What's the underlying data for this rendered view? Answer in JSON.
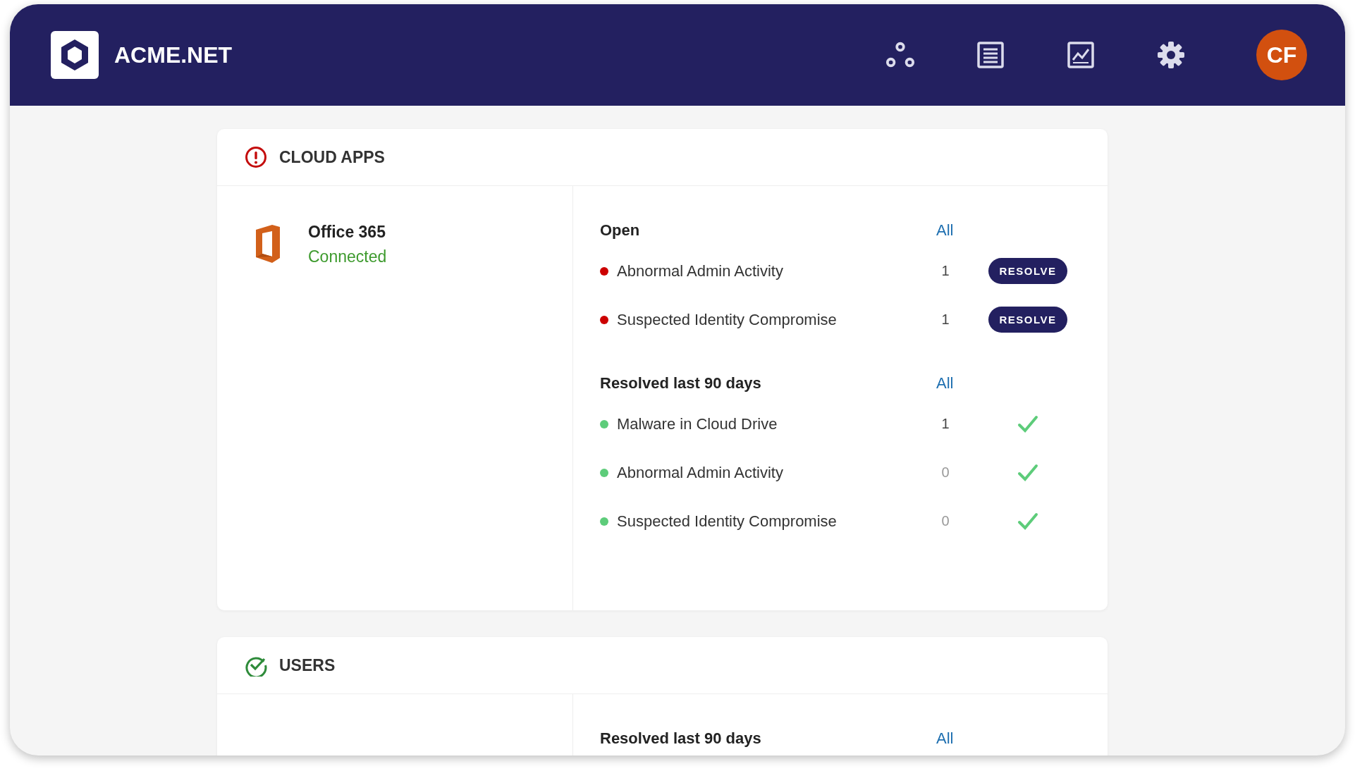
{
  "header": {
    "brand": "ACME.NET",
    "avatar": {
      "initials": "CF"
    }
  },
  "cards": [
    {
      "title": "CLOUD APPS",
      "kind": "alert",
      "app": {
        "name": "Office 365",
        "status": "Connected"
      },
      "sections": [
        {
          "heading": "Open",
          "link": "All",
          "items": [
            {
              "kind": "open",
              "name": "Abnormal Admin Activity",
              "count": "1",
              "dimmed": false,
              "color": "#cc0000",
              "action": "RESOLVE"
            },
            {
              "kind": "open",
              "name": "Suspected Identity Compromise",
              "count": "1",
              "dimmed": false,
              "color": "#cc0000",
              "action": "RESOLVE"
            }
          ]
        },
        {
          "heading": "Resolved last 90 days",
          "link": "All",
          "items": [
            {
              "kind": "resolved",
              "name": "Malware in Cloud Drive",
              "count": "1",
              "dimmed": false,
              "color": "#5dcc7a"
            },
            {
              "kind": "resolved",
              "name": "Abnormal Admin Activity",
              "count": "0",
              "dimmed": true,
              "color": "#5dcc7a"
            },
            {
              "kind": "resolved",
              "name": "Suspected Identity Compromise",
              "count": "0",
              "dimmed": true,
              "color": "#5dcc7a"
            }
          ]
        }
      ]
    },
    {
      "title": "USERS",
      "kind": "ok",
      "sections": [
        {
          "heading": "Resolved last 90 days",
          "link": "All"
        }
      ]
    }
  ]
}
